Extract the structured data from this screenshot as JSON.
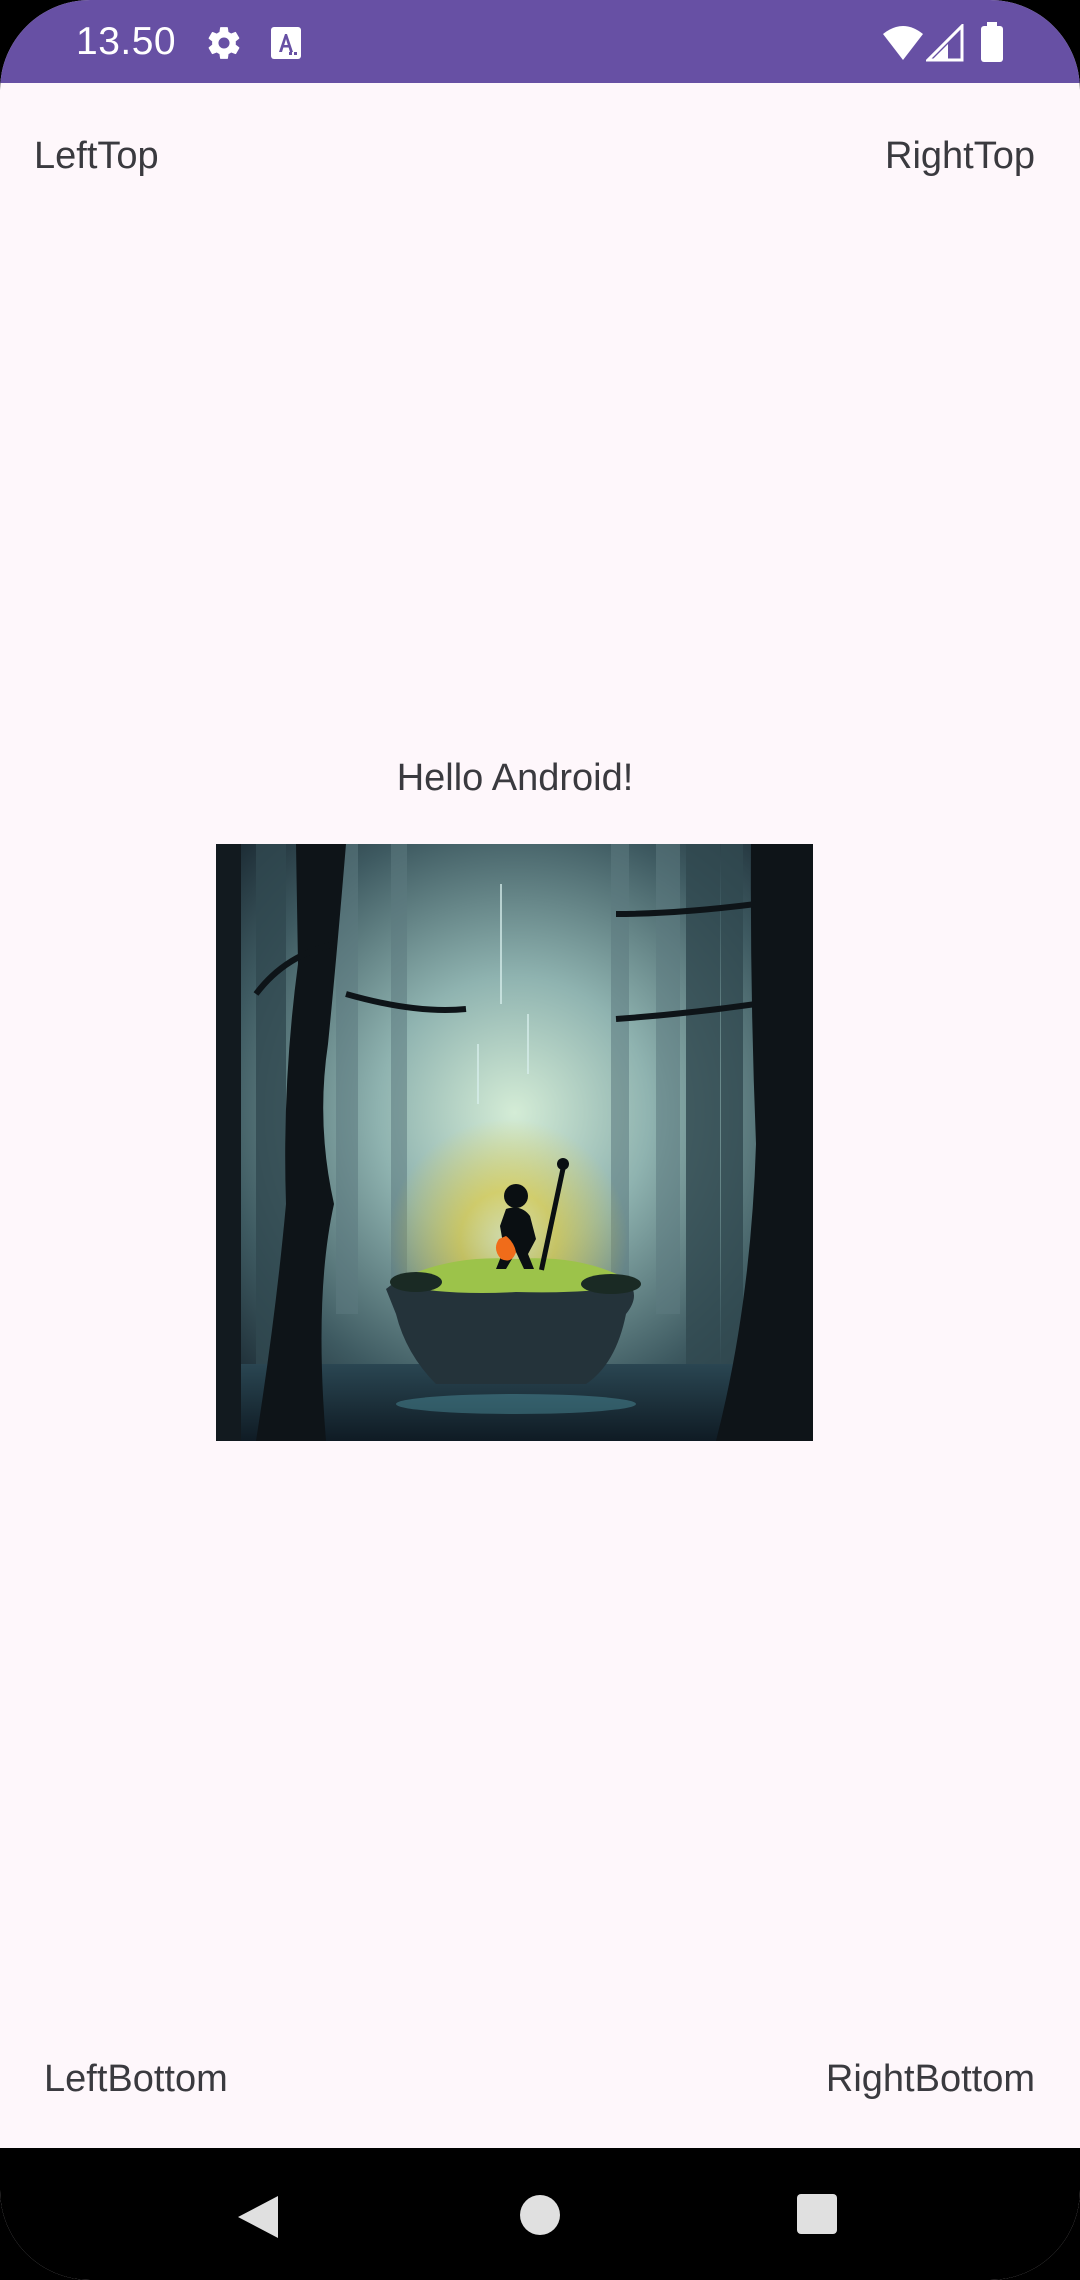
{
  "status_bar": {
    "time": "13.50",
    "icons": [
      "settings-icon",
      "keyboard-a-icon",
      "wifi-icon",
      "signal-icon",
      "battery-icon"
    ],
    "color": "#6750a4"
  },
  "labels": {
    "left_top": "LeftTop",
    "right_top": "RightTop",
    "center": "Hello Android!",
    "left_bottom": "LeftBottom",
    "right_bottom": "RightBottom"
  },
  "image": {
    "description_icon": "forest-wanderer-image"
  },
  "nav_bar": {
    "buttons": [
      "back-icon",
      "home-icon",
      "recents-icon"
    ]
  },
  "colors": {
    "background": "#fef7fb",
    "text": "#3a3a3f"
  }
}
